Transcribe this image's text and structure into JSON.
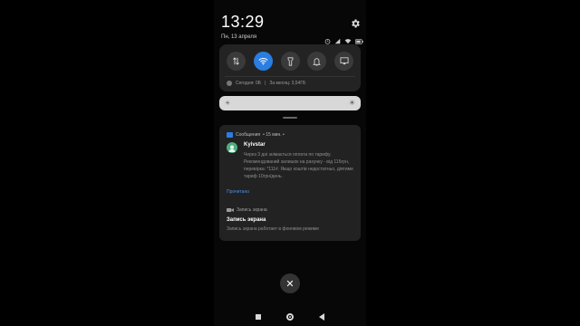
{
  "status": {
    "time": "13:29",
    "date": "Пн, 13 апреля"
  },
  "quick_settings": {
    "toggles": [
      {
        "name": "mobile-data-icon",
        "active": false
      },
      {
        "name": "wifi-icon",
        "active": true
      },
      {
        "name": "flashlight-icon",
        "active": false
      },
      {
        "name": "bell-icon",
        "active": false
      },
      {
        "name": "screencast-icon",
        "active": false
      }
    ],
    "data_today": "Сегодня: 0Б",
    "separator": "|",
    "data_month": "За месяц: 3,54ГБ"
  },
  "brightness": {
    "level": 1.0
  },
  "notifications": {
    "sms": {
      "app_name": "Сообщения",
      "time_ago": "• 15 мин. •",
      "sender": "Kyivstar",
      "body": "Через 3 дні знімається оплата по тарифу. Рекомендований залишок на рахунку - від 115грн, перевірка: *111#. Якщо коштів недостатньо, діятиме тариф 10грн/день.",
      "action": "Прочитано"
    },
    "screen_recording": {
      "app_name": "Запись экрана",
      "title": "Запись экрана",
      "text": "Запись экрана работает в фоновом режиме"
    }
  },
  "colors": {
    "accent": "#2a7de1",
    "link": "#4c8ee8"
  }
}
